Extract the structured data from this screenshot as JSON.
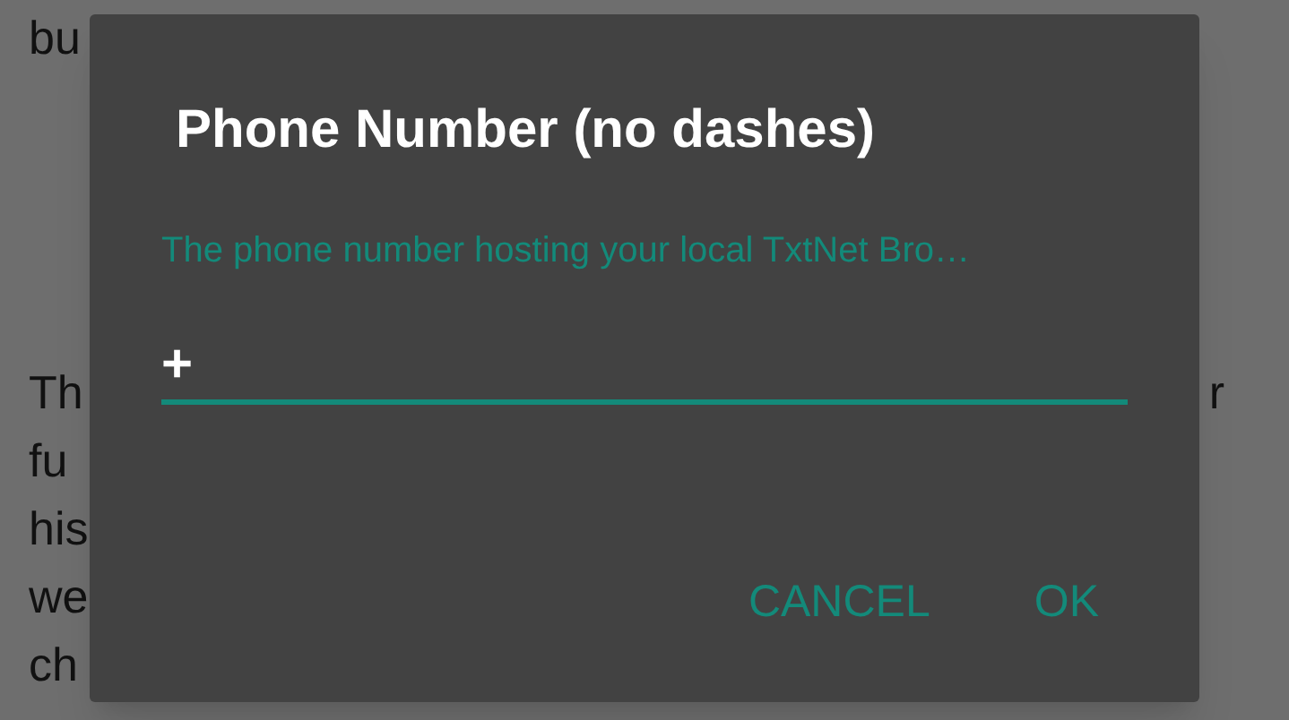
{
  "page": {
    "lines": [
      {
        "left": "bu"
      },
      {
        "left": "Th",
        "right": "r"
      },
      {
        "left": "fu"
      },
      {
        "left": "his"
      },
      {
        "left": "we"
      },
      {
        "left": "ch"
      }
    ]
  },
  "dialog": {
    "title": "Phone Number (no dashes)",
    "hint": "The phone number hosting your local TxtNet Bro…",
    "value": "+",
    "buttons": [
      "CANCEL",
      "OK"
    ]
  }
}
